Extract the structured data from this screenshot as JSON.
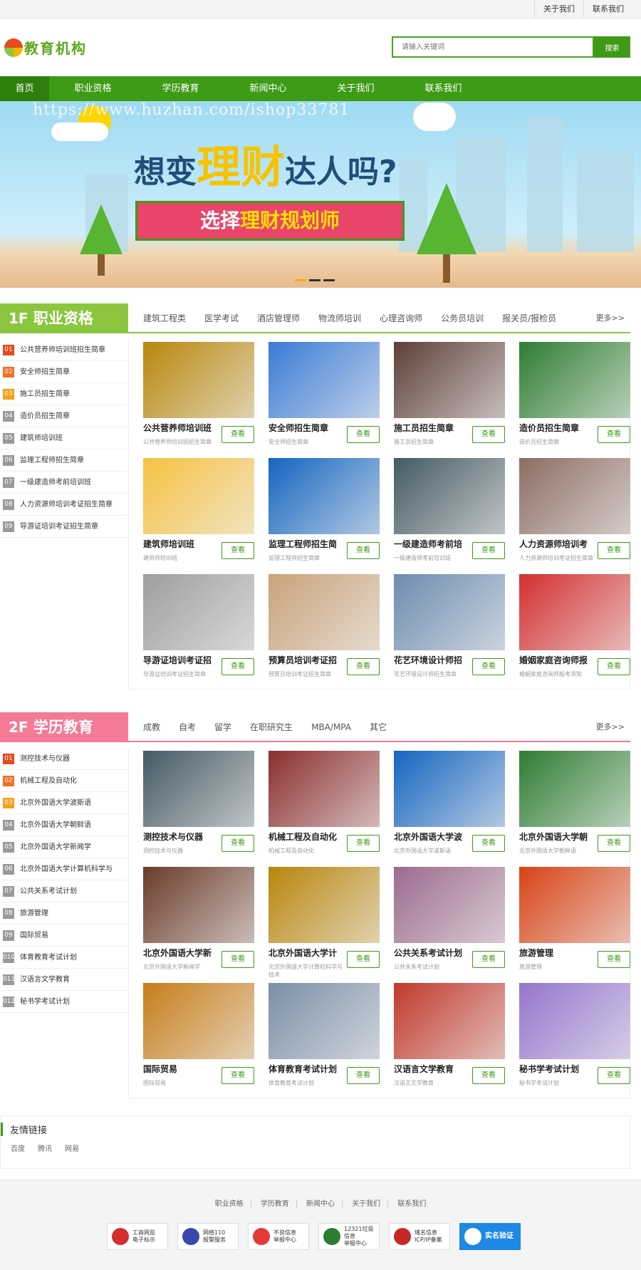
{
  "topbar": {
    "links": [
      "关于我们",
      "联系我们"
    ]
  },
  "logo": {
    "text": "教育机构"
  },
  "search": {
    "placeholder": "请输入关键词",
    "button": "搜索"
  },
  "nav": [
    "首页",
    "职业资格",
    "学历教育",
    "新闻中心",
    "关于我们",
    "联系我们"
  ],
  "banner": {
    "watermark": "https://www.huzhan.com/ishop33781",
    "headline_pre": "想变",
    "headline_big": "理财",
    "headline_post": "达人吗?",
    "sub_pre": "选择",
    "sub_hl": "理财规划师"
  },
  "floors": [
    {
      "num": "1F",
      "title": "职业资格",
      "tabs": [
        "建筑工程类",
        "医学考试",
        "酒店管理师",
        "物流师培训",
        "心理咨询师",
        "公务员培训",
        "报关员/报检员"
      ],
      "more": "更多>>",
      "list": [
        "公共营养师培训班招生简章",
        "安全师招生简章",
        "施工员招生简章",
        "造价员招生简章",
        "建筑师培训班",
        "监理工程师招生简章",
        "一级建造师考前培训班",
        "人力资源师培训考证招生简章",
        "导游证培训考证招生简章"
      ],
      "list_nums": [
        "01",
        "02",
        "03",
        "04",
        "05",
        "06",
        "07",
        "08",
        "09"
      ],
      "cards": [
        {
          "title": "公共营养师培训班",
          "sub": "公共营养师培训班招生简章",
          "btn": "查看"
        },
        {
          "title": "安全师招生简章",
          "sub": "安全师招生简章",
          "btn": "查看"
        },
        {
          "title": "施工员招生简章",
          "sub": "施工员招生简章",
          "btn": "查看"
        },
        {
          "title": "造价员招生简章",
          "sub": "造价员招生简章",
          "btn": "查看"
        },
        {
          "title": "建筑师培训班",
          "sub": "建筑师培训班",
          "btn": "查看"
        },
        {
          "title": "监理工程师招生简",
          "sub": "监理工程师招生简章",
          "btn": "查看"
        },
        {
          "title": "一级建造师考前培",
          "sub": "一级建造师考前培训班",
          "btn": "查看"
        },
        {
          "title": "人力资源师培训考",
          "sub": "人力资源师培训考证招生简章",
          "btn": "查看"
        },
        {
          "title": "导游证培训考证招",
          "sub": "导游证培训考证招生简章",
          "btn": "查看"
        },
        {
          "title": "预算员培训考证招",
          "sub": "预算员培训考证招生简章",
          "btn": "查看"
        },
        {
          "title": "花艺环境设计师招",
          "sub": "花艺环境设计师招生简章",
          "btn": "查看"
        },
        {
          "title": "婚姻家庭咨询师报",
          "sub": "婚姻家庭咨询师报考须知",
          "btn": "查看"
        }
      ]
    },
    {
      "num": "2F",
      "title": "学历教育",
      "tabs": [
        "成教",
        "自考",
        "留学",
        "在职研究生",
        "MBA/MPA",
        "其它"
      ],
      "more": "更多>>",
      "list": [
        "测控技术与仪器",
        "机械工程及自动化",
        "北京外国语大学波斯语",
        "北京外国语大学朝鲜语",
        "北京外国语大学新闻学",
        "北京外国语大学计算机科学与",
        "公共关系考试计划",
        "旅游管理",
        "国际贸易",
        "体育教育考试计划",
        "汉语言文学教育",
        "秘书学考试计划"
      ],
      "list_nums": [
        "01",
        "02",
        "03",
        "04",
        "05",
        "06",
        "07",
        "08",
        "09",
        "010",
        "011",
        "012"
      ],
      "cards": [
        {
          "title": "测控技术与仪器",
          "sub": "测控技术与仪器",
          "btn": "查看"
        },
        {
          "title": "机械工程及自动化",
          "sub": "机械工程及自动化",
          "btn": "查看"
        },
        {
          "title": "北京外国语大学波",
          "sub": "北京外国语大学波斯语",
          "btn": "查看"
        },
        {
          "title": "北京外国语大学朝",
          "sub": "北京外国语大学朝鲜语",
          "btn": "查看"
        },
        {
          "title": "北京外国语大学新",
          "sub": "北京外国语大学新闻学",
          "btn": "查看"
        },
        {
          "title": "北京外国语大学计",
          "sub": "北京外国语大学计算机科学与技术",
          "btn": "查看"
        },
        {
          "title": "公共关系考试计划",
          "sub": "公共关系考试计划",
          "btn": "查看"
        },
        {
          "title": "旅游管理",
          "sub": "旅游管理",
          "btn": "查看"
        },
        {
          "title": "国际贸易",
          "sub": "国际贸易",
          "btn": "查看"
        },
        {
          "title": "体育教育考试计划",
          "sub": "体育教育考试计划",
          "btn": "查看"
        },
        {
          "title": "汉语言文学教育",
          "sub": "汉语言文学教育",
          "btn": "查看"
        },
        {
          "title": "秘书学考试计划",
          "sub": "秘书学考试计划",
          "btn": "查看"
        }
      ]
    }
  ],
  "friend": {
    "title": "友情链接",
    "links": [
      "百度",
      "腾讯",
      "网易"
    ]
  },
  "footer": {
    "links": [
      "职业资格",
      "学历教育",
      "新闻中心",
      "关于我们",
      "联系我们"
    ],
    "badges": [
      {
        "l1": "工商网监",
        "l2": "电子标示",
        "icon": "shield-icon",
        "color": "#d32f2f"
      },
      {
        "l1": "网络110",
        "l2": "报警服务",
        "icon": "police-icon",
        "color": "#3949ab"
      },
      {
        "l1": "不良信息",
        "l2": "举报中心",
        "icon": "report-icon",
        "color": "#e53935"
      },
      {
        "l1": "12321垃圾信息",
        "l2": "举报中心",
        "icon": "hotline-icon",
        "color": "#2e7d32"
      },
      {
        "l1": "域名信息",
        "l2": "ICP/IP备案",
        "icon": "emblem-icon",
        "color": "#c62828"
      },
      {
        "l1": "实名验证",
        "l2": "",
        "icon": "verify-icon",
        "color": "#ffffff"
      }
    ]
  },
  "colors": {
    "brand_green": "#3e9b16",
    "floor1": "#8cc63f",
    "floor2": "#f47a95"
  }
}
